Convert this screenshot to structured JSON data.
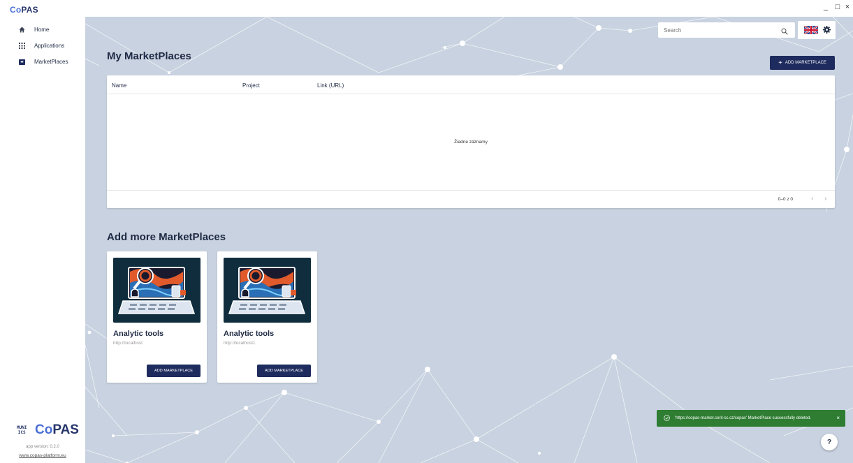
{
  "app": {
    "logo_prefix": "Co",
    "logo_suffix": "PAS",
    "window_controls": {
      "minimize": "_",
      "maximize": "□",
      "close": "×"
    }
  },
  "sidebar": {
    "items": [
      {
        "label": "Home",
        "icon": "home-icon"
      },
      {
        "label": "Applications",
        "icon": "grid-icon"
      },
      {
        "label": "MarketPlaces",
        "icon": "marketplace-icon"
      }
    ],
    "active": "MarketPlaces",
    "footer": {
      "muni_line1": "MUNI",
      "muni_line2": "ICS",
      "logo_prefix": "Co",
      "logo_suffix": "PAS",
      "version": "app version: 0.2.0",
      "website": "www.copas-platform.eu"
    }
  },
  "header": {
    "search_placeholder": "Search",
    "language": "English (UK)"
  },
  "my_marketplaces": {
    "title": "My MarketPlaces",
    "add_button": "ADD MARKETPLACE",
    "columns": [
      "Name",
      "Project",
      "Link (URL)"
    ],
    "rows": [],
    "empty_message": "Žiadne záznamy",
    "pagination": "0–0 z 0"
  },
  "add_more": {
    "title": "Add more MarketPlaces",
    "cards": [
      {
        "name": "Analytic tools",
        "url": "http://localhost",
        "button": "ADD MARKETPLACE"
      },
      {
        "name": "Analytic tools",
        "url": "http://localhost1",
        "button": "ADD MARKETPLACE"
      }
    ]
  },
  "toast": {
    "message": "'https://copas-market.cerit-sc.cz/copas' MarketPlace successfully deleted.",
    "close": "×",
    "color": "#2e7d32"
  },
  "help_label": "?",
  "colors": {
    "primary": "#1e2b5e",
    "background": "#c8d2e0",
    "success": "#2e7d32"
  }
}
